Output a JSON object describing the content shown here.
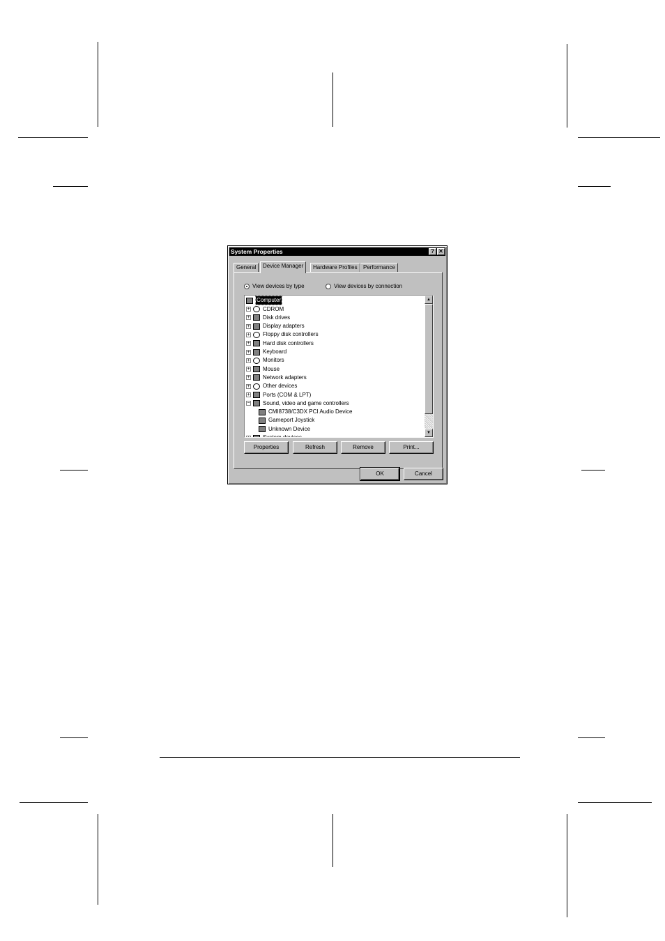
{
  "window": {
    "title": "System Properties",
    "help_btn": "?",
    "close_btn": "✕"
  },
  "tabs": [
    "General",
    "Device Manager",
    "Hardware Profiles",
    "Performance"
  ],
  "active_tab": "Device Manager",
  "view_options": {
    "by_type": "View devices by type",
    "by_connection": "View devices by connection",
    "selected": "by_type"
  },
  "tree": {
    "root": "Computer",
    "items": [
      "CDROM",
      "Disk drives",
      "Display adapters",
      "Floppy disk controllers",
      "Hard disk controllers",
      "Keyboard",
      "Monitors",
      "Mouse",
      "Network adapters",
      "Other devices",
      "Ports (COM & LPT)",
      "Sound, video and game controllers"
    ],
    "children": [
      "CMI8738/C3DX PCI Audio Device",
      "Gameport Joystick",
      "Unknown Device"
    ],
    "partial": "System devices"
  },
  "buttons": {
    "properties": "Properties",
    "refresh": "Refresh",
    "remove": "Remove",
    "print": "Print...",
    "ok": "OK",
    "cancel": "Cancel"
  }
}
